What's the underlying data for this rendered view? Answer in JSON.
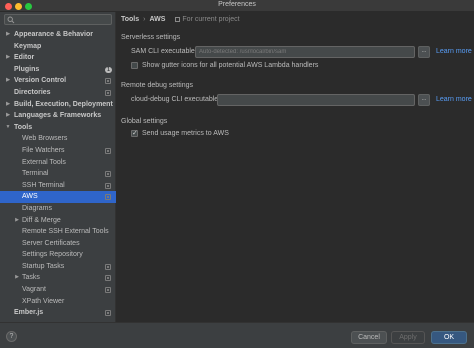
{
  "window": {
    "title": "Preferences"
  },
  "sidebar": {
    "items": [
      {
        "label": "Appearance & Behavior",
        "bold": true,
        "arrow": "right",
        "indent": 0
      },
      {
        "label": "Keymap",
        "bold": true,
        "arrow": "",
        "indent": 0
      },
      {
        "label": "Editor",
        "bold": true,
        "arrow": "right",
        "indent": 0
      },
      {
        "label": "Plugins",
        "bold": true,
        "arrow": "",
        "indent": 0,
        "badge": "1"
      },
      {
        "label": "Version Control",
        "bold": true,
        "arrow": "right",
        "indent": 0,
        "proj": true
      },
      {
        "label": "Directories",
        "bold": true,
        "arrow": "",
        "indent": 0,
        "proj": true
      },
      {
        "label": "Build, Execution, Deployment",
        "bold": true,
        "arrow": "right",
        "indent": 0
      },
      {
        "label": "Languages & Frameworks",
        "bold": true,
        "arrow": "right",
        "indent": 0
      },
      {
        "label": "Tools",
        "bold": true,
        "arrow": "down",
        "indent": 0
      },
      {
        "label": "Web Browsers",
        "bold": false,
        "arrow": "",
        "indent": 1
      },
      {
        "label": "File Watchers",
        "bold": false,
        "arrow": "",
        "indent": 1,
        "proj": true
      },
      {
        "label": "External Tools",
        "bold": false,
        "arrow": "",
        "indent": 1
      },
      {
        "label": "Terminal",
        "bold": false,
        "arrow": "",
        "indent": 1,
        "proj": true
      },
      {
        "label": "SSH Terminal",
        "bold": false,
        "arrow": "",
        "indent": 1,
        "proj": true
      },
      {
        "label": "AWS",
        "bold": false,
        "arrow": "",
        "indent": 1,
        "proj": true,
        "selected": true
      },
      {
        "label": "Diagrams",
        "bold": false,
        "arrow": "",
        "indent": 1
      },
      {
        "label": "Diff & Merge",
        "bold": false,
        "arrow": "right",
        "indent": 1
      },
      {
        "label": "Remote SSH External Tools",
        "bold": false,
        "arrow": "",
        "indent": 1
      },
      {
        "label": "Server Certificates",
        "bold": false,
        "arrow": "",
        "indent": 1
      },
      {
        "label": "Settings Repository",
        "bold": false,
        "arrow": "",
        "indent": 1
      },
      {
        "label": "Startup Tasks",
        "bold": false,
        "arrow": "",
        "indent": 1,
        "proj": true
      },
      {
        "label": "Tasks",
        "bold": false,
        "arrow": "right",
        "indent": 1,
        "proj": true
      },
      {
        "label": "Vagrant",
        "bold": false,
        "arrow": "",
        "indent": 1,
        "proj": true
      },
      {
        "label": "XPath Viewer",
        "bold": false,
        "arrow": "",
        "indent": 1
      },
      {
        "label": "Ember.js",
        "bold": true,
        "arrow": "",
        "indent": 0,
        "proj": true
      }
    ]
  },
  "breadcrumb": {
    "parent": "Tools",
    "separator": "›",
    "current": "AWS",
    "scope": "For current project"
  },
  "serverless": {
    "heading": "Serverless settings",
    "sam_label": "SAM CLI executable:",
    "sam_placeholder": "Auto-detected: /usr/local/bin/sam",
    "browse": "...",
    "learn_more": "Learn more",
    "gutter_label": "Show gutter icons for all potential AWS Lambda handlers",
    "gutter_checked": false
  },
  "remote_debug": {
    "heading": "Remote debug settings",
    "label": "cloud-debug CLI executable:",
    "value": "",
    "browse": "...",
    "learn_more": "Learn more"
  },
  "global": {
    "heading": "Global settings",
    "metrics_label": "Send usage metrics to AWS",
    "metrics_checked": true
  },
  "footer": {
    "help": "?",
    "cancel": "Cancel",
    "apply": "Apply",
    "ok": "OK"
  },
  "colors": {
    "selection": "#2f65ca",
    "link": "#589df6",
    "primary": "#365880",
    "sidebar_bg": "#3c3f41",
    "main_bg": "#2b2b2b"
  }
}
